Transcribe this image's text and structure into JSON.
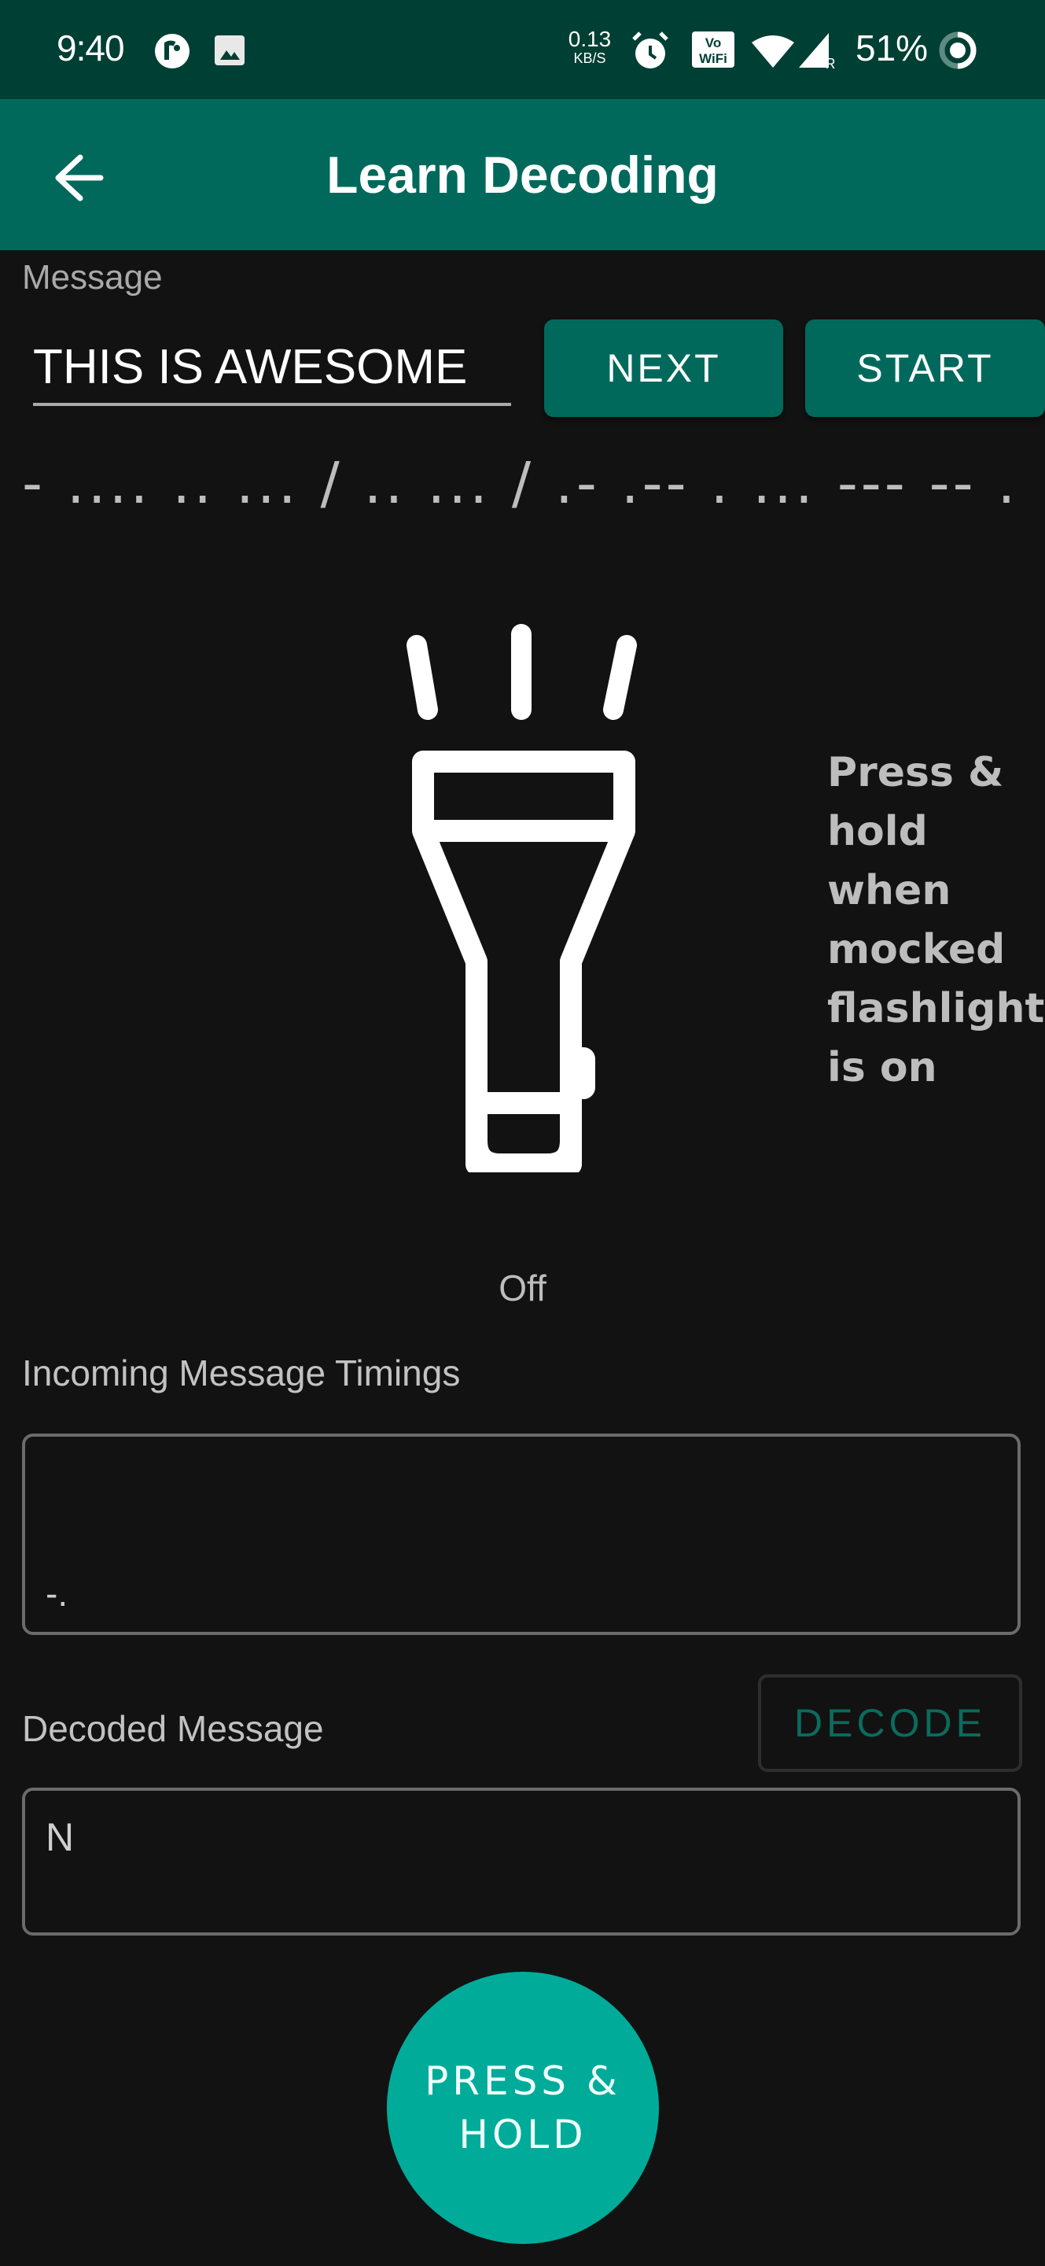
{
  "status_bar": {
    "time": "9:40",
    "left_icons": [
      "pocket-casts-icon",
      "image-notification-icon"
    ],
    "net_speed_value": "0.13",
    "net_speed_unit": "KB/S",
    "right_icons": [
      "alarm-icon",
      "vowifi-icon",
      "wifi-icon",
      "cell-signal-roaming-icon"
    ],
    "battery_percent": "51%"
  },
  "app_bar": {
    "title": "Learn Decoding",
    "back_icon": "arrow-left-icon"
  },
  "message": {
    "label": "Message",
    "value": "THIS IS AWESOME",
    "next_label": "NEXT",
    "start_label": "START"
  },
  "morse_code": "- .... .. ... / .. ... / .- .-- . ... --- -- .",
  "flashlight": {
    "icon": "flashlight-icon",
    "hint": "Press & hold when mocked flashlight is on",
    "state": "Off"
  },
  "timings": {
    "label": "Incoming Message Timings",
    "value": "-."
  },
  "decoded": {
    "label": "Decoded Message",
    "decode_label": "DECODE",
    "value": "N"
  },
  "press_hold": {
    "label": "PRESS & HOLD"
  },
  "colors": {
    "status_bar": "#003f33",
    "app_bar": "#00695c",
    "background": "#121212",
    "accent": "#00ab99",
    "decode_text": "#0b6b5c"
  }
}
